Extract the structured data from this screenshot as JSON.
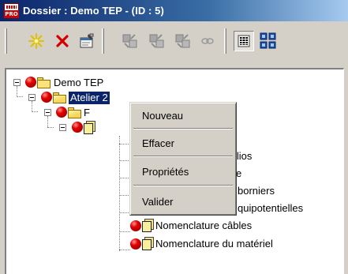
{
  "window": {
    "title": "Dossier : Demo TEP - (ID : 5)",
    "logo_text": "PRO"
  },
  "toolbar": {
    "buttons": [
      {
        "name": "new-button",
        "icon": "sparkle-icon"
      },
      {
        "name": "delete-button",
        "icon": "red-x-icon"
      },
      {
        "name": "properties-button",
        "icon": "properties-icon"
      },
      {
        "name": "tool-button-1",
        "icon": "disabled-tool-icon"
      },
      {
        "name": "tool-button-2",
        "icon": "disabled-tool-icon"
      },
      {
        "name": "tool-button-3",
        "icon": "disabled-tool-icon"
      },
      {
        "name": "link-button",
        "icon": "chain-icon"
      },
      {
        "name": "list-view-button",
        "icon": "list-view-icon"
      },
      {
        "name": "tree-view-button",
        "icon": "tree-view-icon"
      }
    ]
  },
  "tree": {
    "root": "Demo TEP",
    "selected": "Atelier 2",
    "level2_visible": "F",
    "items": [
      "Nomenclature des folios",
      "e",
      "borniers",
      "quipotentielles",
      "Nomenclature câbles",
      "Nomenclature du matériel"
    ],
    "items_prefix_hidden": [
      "ure des folios"
    ]
  },
  "context_menu": {
    "items": [
      "Nouveau",
      "Effacer",
      "Propriétés",
      "Valider"
    ]
  },
  "colors": {
    "titlebar_start": "#0a246a",
    "titlebar_end": "#a6caf0",
    "selection": "#0a246a",
    "face": "#d4d0c8"
  }
}
